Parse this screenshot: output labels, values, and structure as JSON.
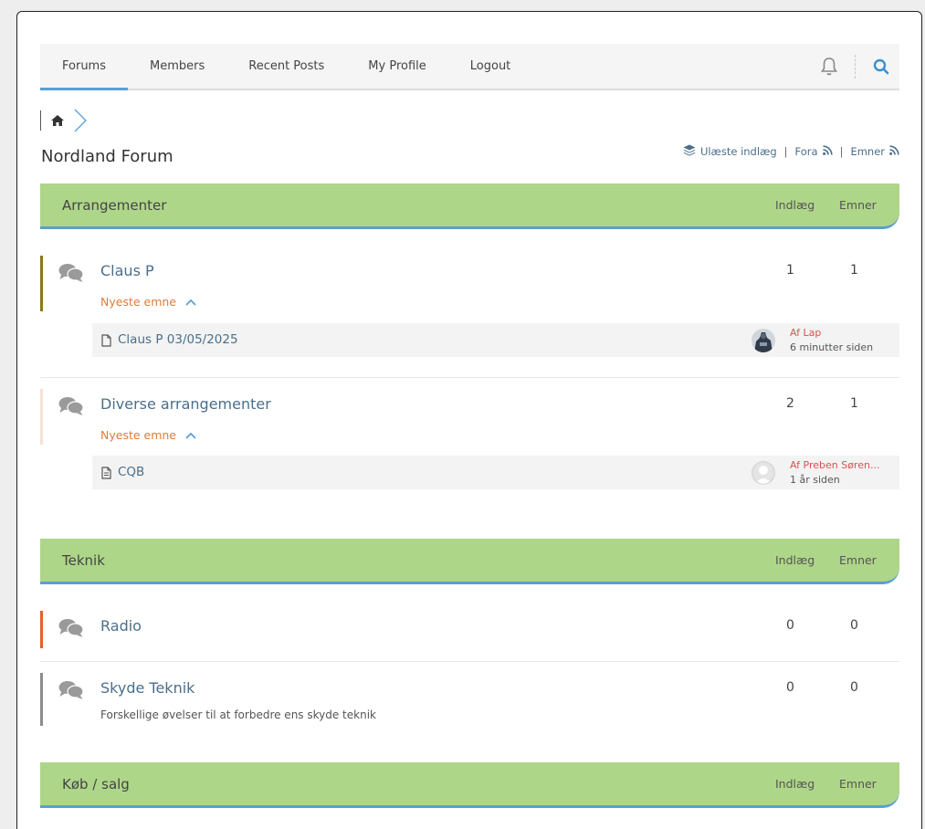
{
  "nav": {
    "items": [
      {
        "label": "Forums",
        "active": true
      },
      {
        "label": "Members"
      },
      {
        "label": "Recent Posts"
      },
      {
        "label": "My Profile"
      },
      {
        "label": "Logout"
      }
    ],
    "icons": [
      "bell-icon",
      "search-icon"
    ]
  },
  "breadcrumb": {
    "icon": "home-icon"
  },
  "page": {
    "title": "Nordland Forum"
  },
  "feeds": {
    "unread": "Ulæste indlæg",
    "forums": "Fora",
    "topics": "Emner",
    "separator": "|"
  },
  "colors": {
    "category_bg": "#aed689",
    "accent": "#5b9fd1",
    "link": "#4a6f8c",
    "newest": "#e07b39",
    "author": "#d9534f"
  },
  "categories": [
    {
      "title": "Arrangementer",
      "col_posts": "Indlæg",
      "col_topics": "Emner",
      "forums": [
        {
          "name": "Claus P",
          "posts": "1",
          "topics": "1",
          "bar_color": "#8a7a1c",
          "newest_label": "Nyeste emne",
          "latest": {
            "title": "Claus P 03/05/2025",
            "by": "Af Lap",
            "time": "6 minutter siden"
          }
        },
        {
          "name": "Diverse arrangementer",
          "posts": "2",
          "topics": "1",
          "bar_color": "#f6e2d6",
          "newest_label": "Nyeste emne",
          "latest": {
            "title": "CQB",
            "by": "Af Preben Søren...",
            "time": "1 år siden"
          }
        }
      ]
    },
    {
      "title": "Teknik",
      "col_posts": "Indlæg",
      "col_topics": "Emner",
      "forums": [
        {
          "name": "Radio",
          "posts": "0",
          "topics": "0",
          "bar_color": "#e0622b"
        },
        {
          "name": "Skyde Teknik",
          "posts": "0",
          "topics": "0",
          "bar_color": "#8c8c8c",
          "description": "Forskellige øvelser til at forbedre ens skyde teknik"
        }
      ]
    },
    {
      "title": "Køb / salg",
      "col_posts": "Indlæg",
      "col_topics": "Emner"
    }
  ]
}
